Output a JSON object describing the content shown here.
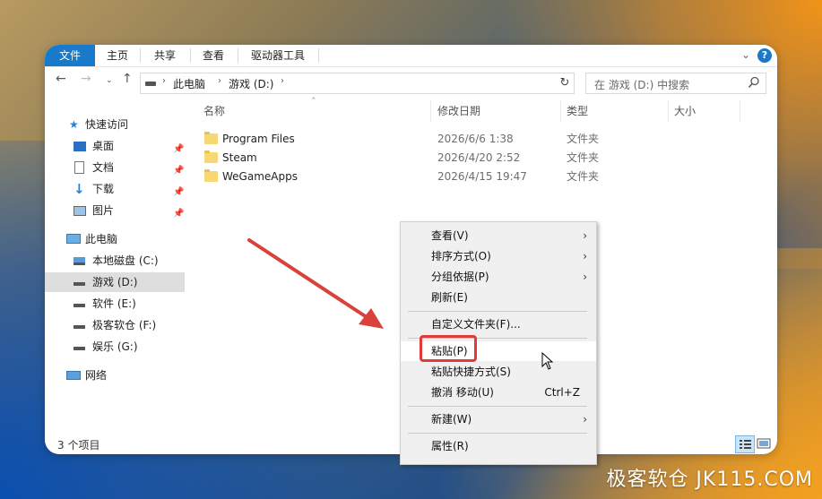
{
  "ribbon": {
    "tabs": [
      {
        "label": "文件",
        "active": true
      },
      {
        "label": "主页",
        "active": false
      },
      {
        "label": "共享",
        "active": false
      },
      {
        "label": "查看",
        "active": false
      },
      {
        "label": "驱动器工具",
        "active": false
      }
    ],
    "help": "?",
    "chevron": "⌄"
  },
  "address": {
    "crumbs": [
      "此电脑",
      "游戏 (D:)"
    ],
    "search_placeholder": "在 游戏 (D:) 中搜索"
  },
  "nav": {
    "quick_access": "快速访问",
    "quick_items": [
      "桌面",
      "文档",
      "下载",
      "图片"
    ],
    "this_pc": "此电脑",
    "drives": [
      "本地磁盘 (C:)",
      "游戏 (D:)",
      "软件 (E:)",
      "极客软仓 (F:)",
      "娱乐 (G:)"
    ],
    "network": "网络"
  },
  "columns": {
    "name": "名称",
    "date": "修改日期",
    "type": "类型",
    "size": "大小"
  },
  "files": [
    {
      "name": "Program Files",
      "date": "2026/6/6 1:38",
      "type": "文件夹"
    },
    {
      "name": "Steam",
      "date": "2026/4/20 2:52",
      "type": "文件夹"
    },
    {
      "name": "WeGameApps",
      "date": "2026/4/15 19:47",
      "type": "文件夹"
    }
  ],
  "status": {
    "count": "3 个项目"
  },
  "context_menu": {
    "view": "查看(V)",
    "sort": "排序方式(O)",
    "group": "分组依据(P)",
    "refresh": "刷新(E)",
    "customize": "自定义文件夹(F)...",
    "paste": "粘贴(P)",
    "paste_shortcut": "粘贴快捷方式(S)",
    "undo": "撤消 移动(U)",
    "undo_shortcut": "Ctrl+Z",
    "new": "新建(W)",
    "properties": "属性(R)"
  },
  "colors": {
    "accent": "#1979ca",
    "highlight": "#e03b3b"
  },
  "watermark": "极客软仓 JK115.COM"
}
